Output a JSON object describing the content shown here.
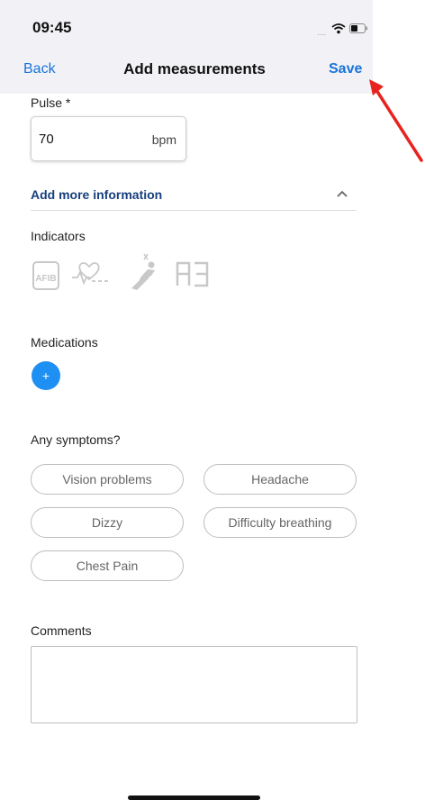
{
  "status_bar": {
    "time": "09:45",
    "signal": "....",
    "icons": [
      "wifi-icon",
      "battery-icon"
    ]
  },
  "nav": {
    "back_label": "Back",
    "title": "Add measurements",
    "save_label": "Save"
  },
  "pulse": {
    "label": "Pulse *",
    "value": "70",
    "unit": "bpm"
  },
  "more_info": {
    "label": "Add more information",
    "icon": "chevron-up-icon"
  },
  "indicators": {
    "label": "Indicators",
    "items": [
      {
        "icon": "afib-icon",
        "text": "AFIB"
      },
      {
        "icon": "heart-pulse-icon"
      },
      {
        "icon": "posture-icon"
      },
      {
        "icon": "a3-icon"
      }
    ]
  },
  "medications": {
    "label": "Medications",
    "add_label": "+"
  },
  "symptoms": {
    "label": "Any symptoms?",
    "chips": [
      "Vision problems",
      "Headache",
      "Dizzy",
      "Difficulty breathing",
      "Chest Pain"
    ]
  },
  "comments": {
    "label": "Comments"
  },
  "colors": {
    "accent": "#1a73d9",
    "link_dark": "#173f7d",
    "add_button": "#1e8ff3",
    "annotation": "#e8231f"
  }
}
